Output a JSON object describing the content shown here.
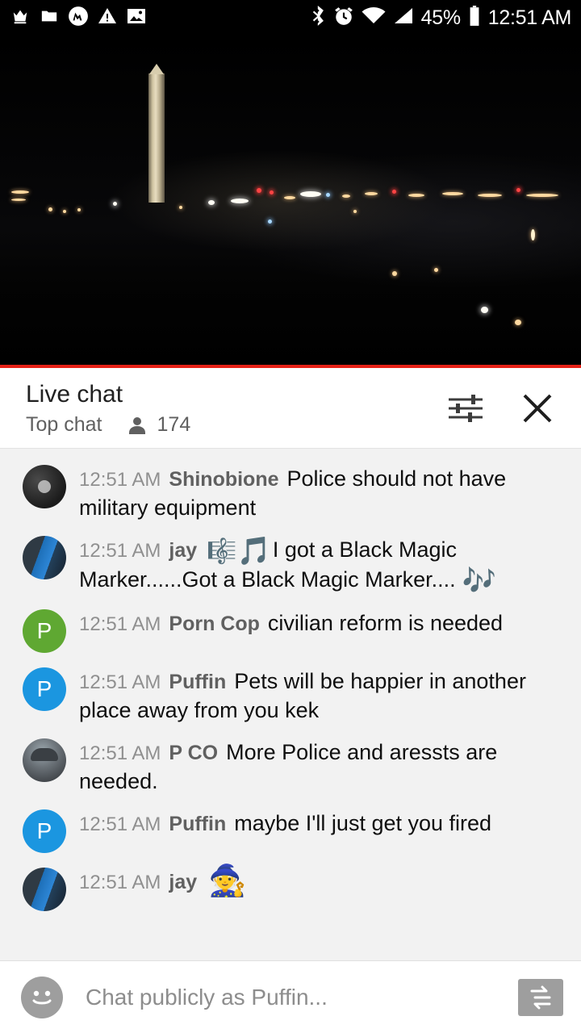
{
  "statusbar": {
    "left_icons": [
      "crown-icon",
      "folder-icon",
      "messenger-icon",
      "warning-icon",
      "image-icon"
    ],
    "right_icons": [
      "bluetooth-icon",
      "alarm-icon",
      "wifi-icon",
      "signal-icon"
    ],
    "battery_percent": "45%",
    "time": "12:51 AM"
  },
  "video": {
    "progress_percent": 100,
    "progress_color": "#e62117"
  },
  "chat": {
    "title": "Live chat",
    "mode": "Top chat",
    "viewers": "174",
    "settings_icon": "sliders-icon",
    "close_icon": "close-icon"
  },
  "messages": [
    {
      "avatar": "av-dark",
      "avatar_letter": "",
      "timestamp": "12:51 AM",
      "author": "Shinobione",
      "text": "Police should not have military equipment"
    },
    {
      "avatar": "av-jay",
      "avatar_letter": "",
      "timestamp": "12:51 AM",
      "author": "jay",
      "text": "I got a Black Magic Marker......Got a Black Magic Marker....",
      "leading_emoji": "🎼",
      "leading_emoji2": "🎵",
      "trailing_emoji": "🎶"
    },
    {
      "avatar": "av-green",
      "avatar_letter": "P",
      "timestamp": "12:51 AM",
      "author": "Porn Cop",
      "text": "civilian reform is needed"
    },
    {
      "avatar": "av-blue",
      "avatar_letter": "P",
      "timestamp": "12:51 AM",
      "author": "Puffin",
      "text": "Pets will be happier in another place away from you kek"
    },
    {
      "avatar": "av-photo",
      "avatar_letter": "",
      "timestamp": "12:51 AM",
      "author": "P CO",
      "text": "More Police and aressts are needed."
    },
    {
      "avatar": "av-blue",
      "avatar_letter": "P",
      "timestamp": "12:51 AM",
      "author": "Puffin",
      "text": "maybe I'll just get you fired"
    },
    {
      "avatar": "av-jay",
      "avatar_letter": "",
      "timestamp": "12:51 AM",
      "author": "jay",
      "text": "",
      "trailing_emoji2": "🧙"
    }
  ],
  "composer": {
    "emoji_icon": "emoji-face-icon",
    "placeholder": "Chat publicly as Puffin...",
    "send_icon": "send-icon"
  }
}
